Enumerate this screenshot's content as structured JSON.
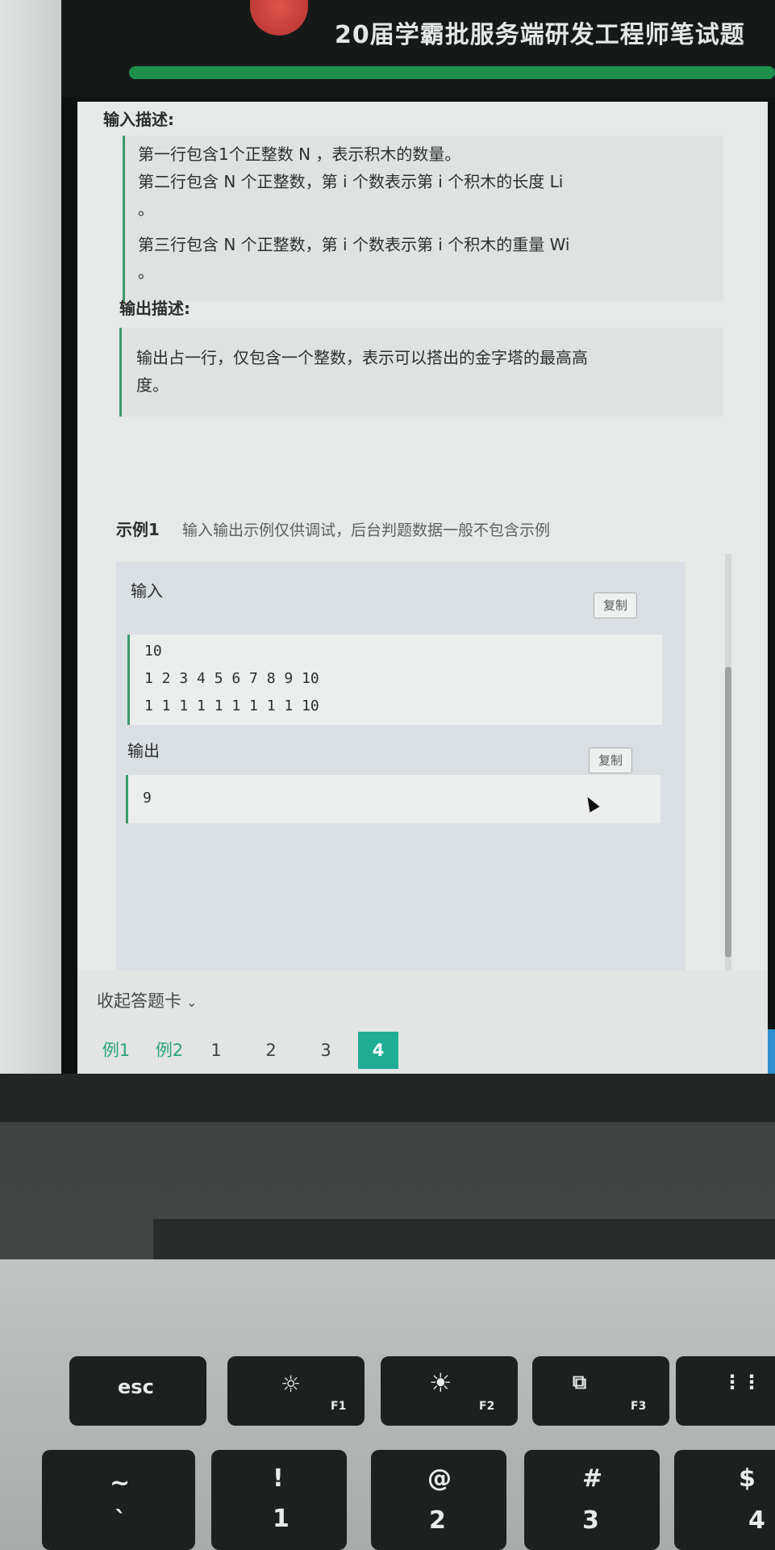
{
  "header": {
    "title": "20届学霸批服务端研发工程师笔试题",
    "progress": 1.0
  },
  "input_desc": {
    "title": "输入描述:",
    "lines": [
      "第一行包含1个正整数 N ，表示积木的数量。",
      "第二行包含 N 个正整数，第 i 个数表示第 i 个积木的长度 Li",
      "。",
      "第三行包含 N 个正整数，第 i 个数表示第 i 个积木的重量 Wi",
      "。"
    ]
  },
  "output_desc": {
    "title": "输出描述:",
    "lines": [
      "输出占一行，仅包含一个整数，表示可以搭出的金字塔的最高高",
      "度。"
    ]
  },
  "example": {
    "title": "示例1",
    "note": "输入输出示例仅供调试，后台判题数据一般不包含示例",
    "input_label": "输入",
    "output_label": "输出",
    "copy_label": "复制",
    "input_lines": [
      "10",
      "1 2 3 4 5 6 7 8 9 10",
      "1 1 1 1 1 1 1 1 1 10"
    ],
    "output_lines": [
      "9"
    ]
  },
  "footer": {
    "collapse_label": "收起答题卡",
    "tabs": [
      "例1",
      "例2",
      "1",
      "2",
      "3",
      "4"
    ],
    "active_tab": "4"
  },
  "keyboard": {
    "row1": [
      {
        "label": "esc"
      },
      {
        "label": "F1",
        "icon": "brightness-down-icon"
      },
      {
        "label": "F2",
        "icon": "brightness-up-icon"
      },
      {
        "label": "F3",
        "icon": "mission-control-icon"
      },
      {
        "label": "",
        "icon": "launchpad-icon"
      }
    ],
    "row2": [
      {
        "top": "~",
        "bottom": "`"
      },
      {
        "top": "!",
        "bottom": "1"
      },
      {
        "top": "@",
        "bottom": "2"
      },
      {
        "top": "#",
        "bottom": "3"
      },
      {
        "top": "$",
        "bottom": "4"
      }
    ]
  },
  "colors": {
    "accent": "#1fae94",
    "border_green": "#3a9a6b",
    "example_tab": "#2aa37c"
  }
}
